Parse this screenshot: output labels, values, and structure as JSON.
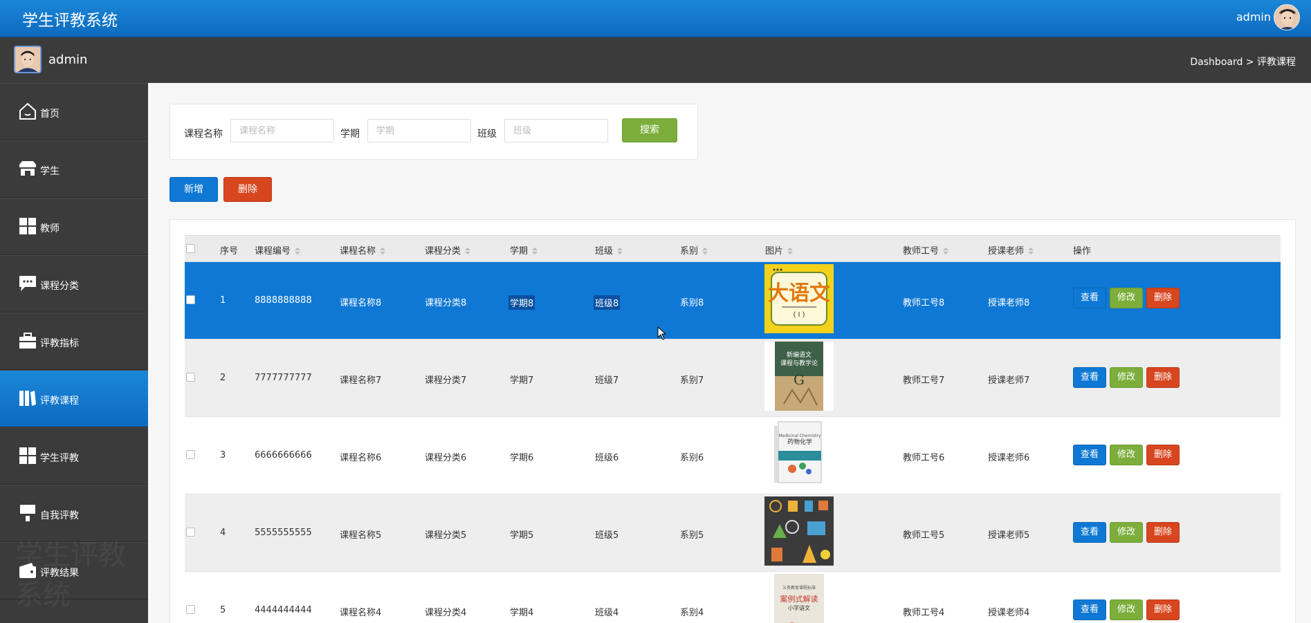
{
  "header": {
    "title": "学生评教系统",
    "user": "admin"
  },
  "subbar": {
    "user": "admin",
    "breadcrumb": "Dashboard > 评教课程"
  },
  "sidebar": {
    "items": [
      {
        "label": "首页",
        "icon": "home-icon"
      },
      {
        "label": "学生",
        "icon": "shop-icon"
      },
      {
        "label": "教师",
        "icon": "grid-icon"
      },
      {
        "label": "课程分类",
        "icon": "chat-icon"
      },
      {
        "label": "评教指标",
        "icon": "briefcase-icon"
      },
      {
        "label": "评教课程",
        "icon": "book-icon",
        "active": true
      },
      {
        "label": "学生评教",
        "icon": "grid-icon"
      },
      {
        "label": "自我评教",
        "icon": "brush-icon"
      },
      {
        "label": "评教结果",
        "icon": "wallet-icon"
      }
    ],
    "watermark": "学生评教系统"
  },
  "search": {
    "course_name_label": "课程名称",
    "course_name_placeholder": "课程名称",
    "term_label": "学期",
    "term_placeholder": "学期",
    "class_label": "班级",
    "class_placeholder": "班级",
    "search_button": "搜索"
  },
  "actions": {
    "add": "新增",
    "delete": "删除"
  },
  "table": {
    "headers": [
      "序号",
      "课程编号",
      "课程名称",
      "课程分类",
      "学期",
      "班级",
      "系别",
      "图片",
      "教师工号",
      "授课老师",
      "操作"
    ],
    "rows": [
      {
        "index": "1",
        "code": "8888888888",
        "name": "课程名称8",
        "category": "课程分类8",
        "term": "学期8",
        "class": "班级8",
        "dept": "系别8",
        "teacher_id": "教师工号8",
        "teacher": "授课老师8",
        "image": "book-cover-yuwen"
      },
      {
        "index": "2",
        "code": "7777777777",
        "name": "课程名称7",
        "category": "课程分类7",
        "term": "学期7",
        "class": "班级7",
        "dept": "系别7",
        "teacher_id": "教师工号7",
        "teacher": "授课老师7",
        "image": "book-cover-green"
      },
      {
        "index": "3",
        "code": "6666666666",
        "name": "课程名称6",
        "category": "课程分类6",
        "term": "学期6",
        "class": "班级6",
        "dept": "系别6",
        "teacher_id": "教师工号6",
        "teacher": "授课老师6",
        "image": "book-cover-white"
      },
      {
        "index": "4",
        "code": "5555555555",
        "name": "课程名称5",
        "category": "课程分类5",
        "term": "学期5",
        "class": "班级5",
        "dept": "系别5",
        "teacher_id": "教师工号5",
        "teacher": "授课老师5",
        "image": "science-icons"
      },
      {
        "index": "5",
        "code": "4444444444",
        "name": "课程名称4",
        "category": "课程分类4",
        "term": "学期4",
        "class": "班级4",
        "dept": "系别4",
        "teacher_id": "教师工号4",
        "teacher": "授课老师4",
        "image": "book-cover-case"
      }
    ],
    "row_actions": {
      "view": "查看",
      "edit": "修改",
      "delete": "删除"
    }
  },
  "colors": {
    "primary": "#0f78d4",
    "success": "#7dae3c",
    "danger": "#d8461f",
    "sidebar": "#3b3b3b"
  }
}
